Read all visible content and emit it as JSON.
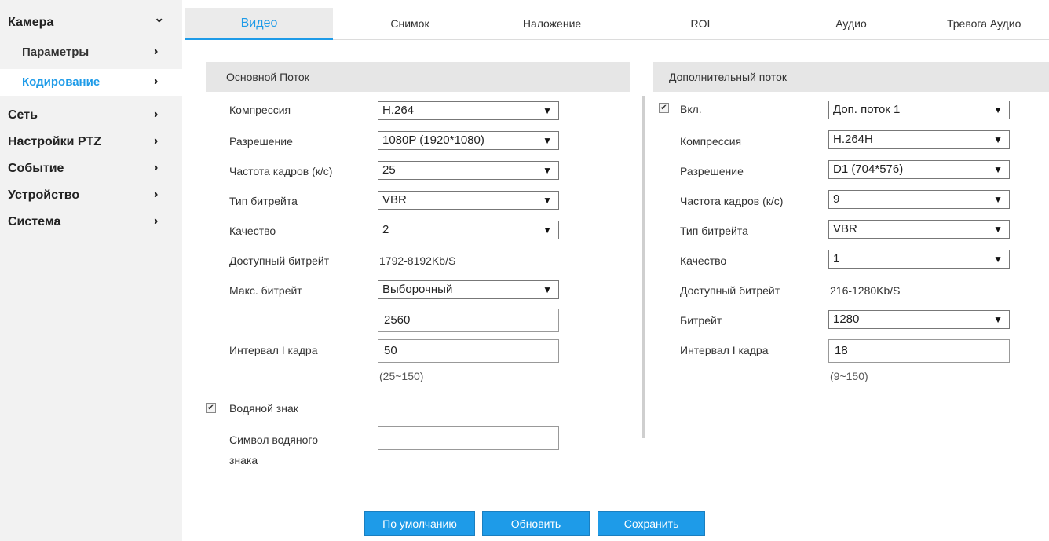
{
  "sidebar": {
    "items": [
      {
        "label": "Камера",
        "arrow": "⌄"
      },
      {
        "label": "Параметры",
        "arrow": "›"
      },
      {
        "label": "Кодирование",
        "arrow": "›"
      },
      {
        "label": "Сеть",
        "arrow": "›"
      },
      {
        "label": "Настройки PTZ",
        "arrow": "›"
      },
      {
        "label": "Событие",
        "arrow": "›"
      },
      {
        "label": "Устройство",
        "arrow": "›"
      },
      {
        "label": "Система",
        "arrow": "›"
      }
    ]
  },
  "tabs": [
    "Видео",
    "Снимок",
    "Наложение",
    "ROI",
    "Аудио",
    "Тревога Аудио"
  ],
  "main_stream": {
    "title": "Основной Поток",
    "compression_label": "Компрессия",
    "compression": "H.264",
    "resolution_label": "Разрешение",
    "resolution": "1080P (1920*1080)",
    "framerate_label": "Частота кадров (к/с)",
    "framerate": "25",
    "bitrate_type_label": "Тип битрейта",
    "bitrate_type": "VBR",
    "quality_label": "Качество",
    "quality": "2",
    "available_label": "Доступный битрейт",
    "available": "1792-8192Kb/S",
    "max_bitrate_label": "Макс. битрейт",
    "max_bitrate": "Выборочный",
    "custom_bitrate": "2560",
    "iframe_label": "Интервал I кадра",
    "iframe": "50",
    "iframe_range": "(25~150)",
    "watermark_label": "Водяной знак",
    "watermark_checked": true,
    "watermark_symbol_label_1": "Символ водяного",
    "watermark_symbol_label_2": "знака",
    "watermark_symbol": ""
  },
  "sub_stream": {
    "title": "Дополнительный поток",
    "enable_label": "Вкл.",
    "enable_checked": true,
    "stream": "Доп. поток 1",
    "compression_label": "Компрессия",
    "compression": "H.264H",
    "resolution_label": "Разрешение",
    "resolution": "D1 (704*576)",
    "framerate_label": "Частота кадров (к/с)",
    "framerate": "9",
    "bitrate_type_label": "Тип битрейта",
    "bitrate_type": "VBR",
    "quality_label": "Качество",
    "quality": "1",
    "available_label": "Доступный битрейт",
    "available": "216-1280Kb/S",
    "bitrate_label": "Битрейт",
    "bitrate": "1280",
    "iframe_label": "Интервал I кадра",
    "iframe": "18",
    "iframe_range": "(9~150)"
  },
  "buttons": {
    "default": "По умолчанию",
    "refresh": "Обновить",
    "save": "Сохранить"
  },
  "icons": {
    "caret": "▼",
    "check": "✔"
  },
  "colors": {
    "accent": "#1e9be8",
    "sidebar_bg": "#f2f2f2",
    "header_bg": "#e6e6e6"
  }
}
